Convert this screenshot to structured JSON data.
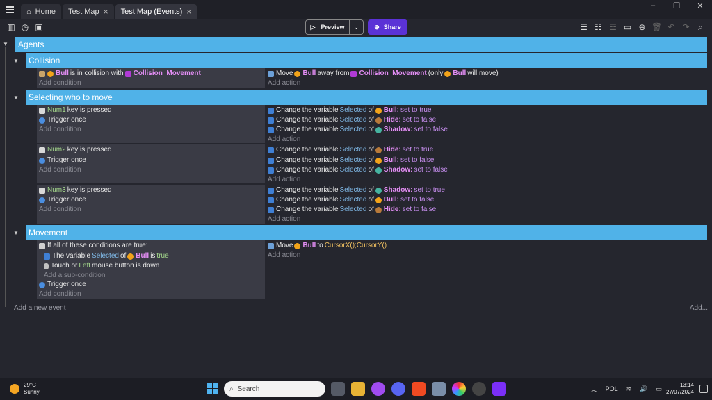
{
  "window": {
    "tabs": [
      {
        "label": "Home"
      },
      {
        "label": "Test Map"
      },
      {
        "label": "Test Map (Events)"
      }
    ]
  },
  "toolbar": {
    "preview_label": "Preview",
    "share_label": "Share"
  },
  "groups": {
    "agents": "Agents",
    "collision": "Collision",
    "selecting": "Selecting who to move",
    "movement": "Movement"
  },
  "collision_event": {
    "cond_obj": "Bull",
    "cond_text": "is in collision with",
    "cond_target": "Collision_Movement",
    "add_condition": "Add condition",
    "act_move": "Move",
    "act_obj": "Bull",
    "act_away": "away from",
    "act_target": "Collision_Movement",
    "act_only_pre": "(only",
    "act_only_obj": "Bull",
    "act_only_post": "will move)",
    "add_action": "Add action"
  },
  "select_events": [
    {
      "key": "Num1",
      "key_text": "key is pressed",
      "trigger": "Trigger once",
      "add_condition": "Add condition",
      "actions": [
        {
          "obj": "Bull:",
          "value": "set to true"
        },
        {
          "obj": "Hide:",
          "value": "set to false"
        },
        {
          "obj": "Shadow:",
          "value": "set to false"
        }
      ],
      "add_action": "Add action"
    },
    {
      "key": "Num2",
      "key_text": "key is pressed",
      "trigger": "Trigger once",
      "add_condition": "Add condition",
      "actions": [
        {
          "obj": "Hide:",
          "value": "set to true"
        },
        {
          "obj": "Bull:",
          "value": "set to false"
        },
        {
          "obj": "Shadow:",
          "value": "set to false"
        }
      ],
      "add_action": "Add action"
    },
    {
      "key": "Num3",
      "key_text": "key is pressed",
      "trigger": "Trigger once",
      "add_condition": "Add condition",
      "actions": [
        {
          "obj": "Shadow:",
          "value": "set to true"
        },
        {
          "obj": "Bull:",
          "value": "set to false"
        },
        {
          "obj": "Hide:",
          "value": "set to false"
        }
      ],
      "add_action": "Add action"
    }
  ],
  "action_text": {
    "change": "Change the variable",
    "variable": "Selected",
    "of": "of"
  },
  "movement_event": {
    "if_all": "If all of these conditions are true:",
    "var_pre": "The variable",
    "var_name": "Selected",
    "var_of": "of",
    "var_obj": "Bull",
    "var_is": "is",
    "var_val": "true",
    "touch_pre": "Touch or",
    "touch_key": "Left",
    "touch_post": "mouse button is down",
    "add_sub": "Add a sub-condition",
    "trigger": "Trigger once",
    "add_condition": "Add condition",
    "act_move": "Move",
    "act_obj": "Bull",
    "act_to": "to",
    "act_expr": "CursorX();CursorY()",
    "add_action": "Add action"
  },
  "footer": {
    "add_event": "Add a new event",
    "add_right": "Add..."
  },
  "taskbar": {
    "temp": "29°C",
    "weather": "Sunny",
    "search": "Search",
    "lang": "POL",
    "time": "13:14",
    "date": "27/07/2024"
  }
}
